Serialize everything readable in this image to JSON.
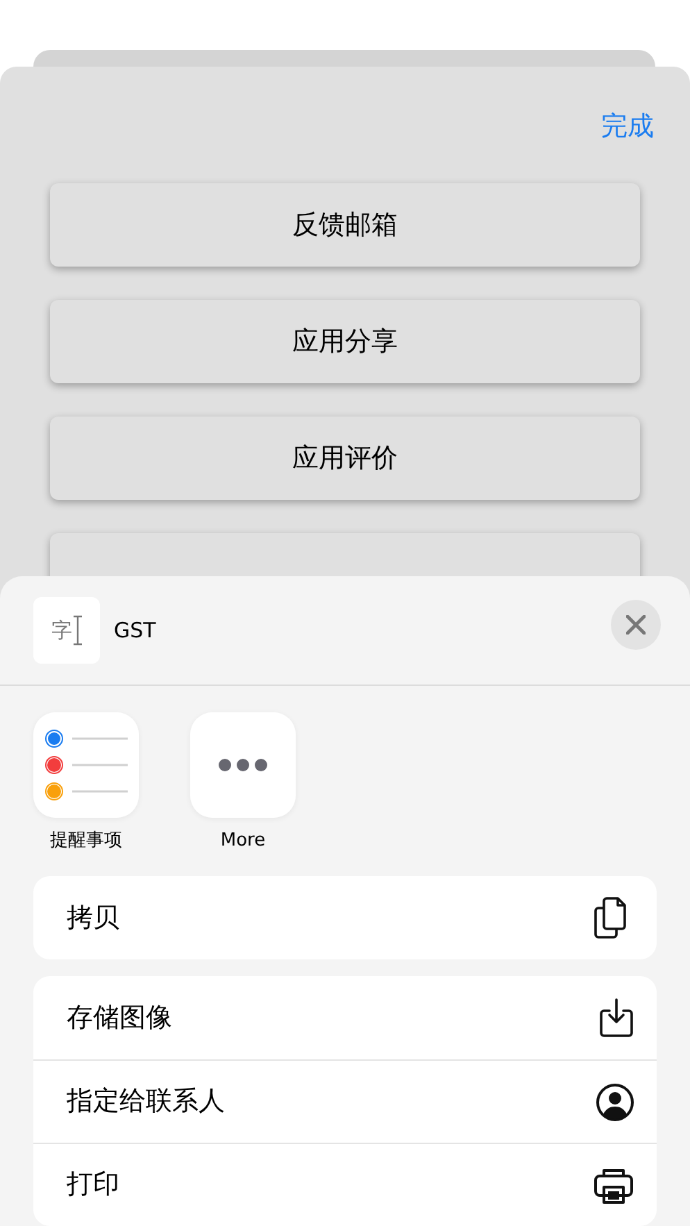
{
  "sheet": {
    "done_button": "完成",
    "buttons": [
      "反馈邮箱",
      "应用分享",
      "应用评价"
    ],
    "covered_button": true
  },
  "share_sheet": {
    "preview": {
      "glyph": "字",
      "title": "GST"
    },
    "apps": [
      {
        "kind": "reminders",
        "label": "提醒事项"
      },
      {
        "kind": "more",
        "label": "More"
      }
    ],
    "action_groups": [
      [
        {
          "kind": "copy",
          "label": "拷贝"
        }
      ],
      [
        {
          "kind": "save",
          "label": "存储图像"
        },
        {
          "kind": "contact",
          "label": "指定给联系人"
        },
        {
          "kind": "print",
          "label": "打印"
        }
      ]
    ]
  }
}
